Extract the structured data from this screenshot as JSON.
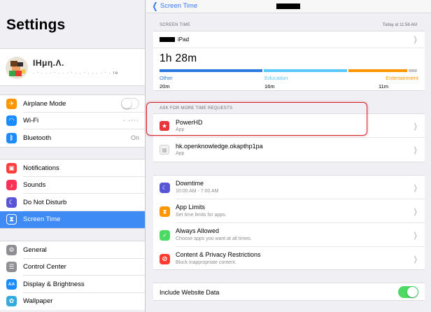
{
  "sidebar": {
    "title": "Settings",
    "profile": {
      "name": "IHμη.Λ.",
      "subtitle": "· ‧ · · · ‧ · · · ‧ · · ‧ · · · · ‧ · re"
    },
    "group1": [
      {
        "label": "Airplane Mode",
        "icon": "airplane-icon",
        "color": "#ff9500",
        "glyph": "✈"
      },
      {
        "label": "Wi-Fi",
        "icon": "wifi-icon",
        "color": "#1a8cff",
        "glyph": "◠",
        "value": "· ·‧‧·"
      },
      {
        "label": "Bluetooth",
        "icon": "bluetooth-icon",
        "color": "#1a8cff",
        "glyph": "ᛒ",
        "value": "On"
      }
    ],
    "group2": [
      {
        "label": "Notifications",
        "icon": "notifications-icon",
        "color": "#fc3d39",
        "glyph": "▣"
      },
      {
        "label": "Sounds",
        "icon": "sounds-icon",
        "color": "#fc3158",
        "glyph": "♪"
      },
      {
        "label": "Do Not Disturb",
        "icon": "moon-icon",
        "color": "#5856d6",
        "glyph": "☾"
      },
      {
        "label": "Screen Time",
        "icon": "hourglass-icon",
        "color": "#5856d6",
        "glyph": "⧗"
      }
    ],
    "group3": [
      {
        "label": "General",
        "icon": "gear-icon",
        "color": "#8e8e93",
        "glyph": "⚙"
      },
      {
        "label": "Control Center",
        "icon": "control-center-icon",
        "color": "#8e8e93",
        "glyph": "☰"
      },
      {
        "label": "Display & Brightness",
        "icon": "display-icon",
        "color": "#1a8cff",
        "glyph": "AA"
      },
      {
        "label": "Wallpaper",
        "icon": "wallpaper-icon",
        "color": "#34aadc",
        "glyph": "✿"
      }
    ]
  },
  "nav": {
    "back_label": "Screen Time"
  },
  "screen_time": {
    "header": "SCREEN TIME",
    "timestamp": "Today at 11:56 AM",
    "device": "iPad",
    "total": "1h 28m",
    "categories": [
      {
        "name": "Other",
        "value": "20m",
        "color": "#2a7ae2"
      },
      {
        "name": "Education",
        "value": "16m",
        "color": "#5ac8fa"
      },
      {
        "name": "Entertainment",
        "value": "11m",
        "color": "#ff9500"
      }
    ],
    "rest_color": "#c7c7cc"
  },
  "requests": {
    "header": "ASK FOR MORE TIME REQUESTS",
    "items": [
      {
        "name": "PowerHD",
        "sub": "App"
      },
      {
        "name": "hk.openknowledge.okapthp1pa",
        "sub": "App"
      }
    ]
  },
  "options": [
    {
      "title": "Downtime",
      "sub": "10:00 AM - 7:00 AM",
      "icon": "downtime-icon",
      "color": "#5856d6",
      "glyph": "☾"
    },
    {
      "title": "App Limits",
      "sub": "Set time limits for apps.",
      "icon": "app-limits-icon",
      "color": "#ff9500",
      "glyph": "⧗"
    },
    {
      "title": "Always Allowed",
      "sub": "Choose apps you want at all times.",
      "icon": "always-allowed-icon",
      "color": "#4cd964",
      "glyph": "✓"
    },
    {
      "title": "Content & Privacy Restrictions",
      "sub": "Block inappropriate content.",
      "icon": "restrictions-icon",
      "color": "#ff3b30",
      "glyph": "⊘"
    }
  ],
  "website": {
    "label": "Include Website Data"
  }
}
